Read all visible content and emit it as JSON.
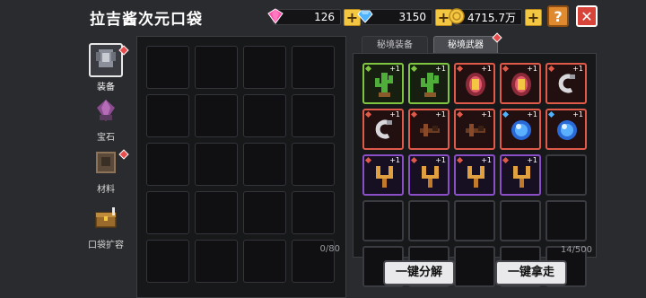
{
  "header": {
    "title": "拉吉酱次元口袋",
    "gems": "126",
    "diamonds": "3150",
    "gold": "4715.7万",
    "help_label": "?",
    "close_label": "✕"
  },
  "sidebar": {
    "items": [
      {
        "label": "装备",
        "icon": "armor-icon",
        "selected": true,
        "badge": true
      },
      {
        "label": "宝石",
        "icon": "gem-icon",
        "selected": false,
        "badge": false
      },
      {
        "label": "材料",
        "icon": "material-icon",
        "selected": false,
        "badge": true
      },
      {
        "label": "口袋扩容",
        "icon": "chest-icon",
        "selected": false,
        "badge": false
      }
    ]
  },
  "left_panel": {
    "count": "0/80",
    "slots": 20
  },
  "tabs": [
    {
      "label": "秘境装备",
      "active": false
    },
    {
      "label": "秘境武器",
      "active": true,
      "badge": true
    }
  ],
  "right_panel": {
    "count": "14/500",
    "items": [
      {
        "icon": "cactus-icon",
        "rarity": "green",
        "level": "+1"
      },
      {
        "icon": "cactus-icon",
        "rarity": "green",
        "level": "+1"
      },
      {
        "icon": "drum-icon",
        "rarity": "red",
        "level": "+1"
      },
      {
        "icon": "drum-icon",
        "rarity": "red",
        "level": "+1"
      },
      {
        "icon": "hook-icon",
        "rarity": "red",
        "level": "+1"
      },
      {
        "icon": "hook-icon",
        "rarity": "red",
        "level": "+1"
      },
      {
        "icon": "crossbow-icon",
        "rarity": "red",
        "level": "+1"
      },
      {
        "icon": "crossbow-icon",
        "rarity": "red",
        "level": "+1"
      },
      {
        "icon": "orb-icon",
        "rarity": "red",
        "level": "+1"
      },
      {
        "icon": "orb-icon",
        "rarity": "red",
        "level": "+1"
      },
      {
        "icon": "slingshot-icon",
        "rarity": "purple",
        "level": "+1"
      },
      {
        "icon": "slingshot-icon",
        "rarity": "purple",
        "level": "+1"
      },
      {
        "icon": "slingshot-icon",
        "rarity": "purple",
        "level": "+1"
      },
      {
        "icon": "slingshot-icon",
        "rarity": "purple",
        "level": "+1"
      }
    ],
    "empty_slots": 11
  },
  "buttons": {
    "decompose_label": "一键分解",
    "take_all_label": "一键拿走"
  }
}
